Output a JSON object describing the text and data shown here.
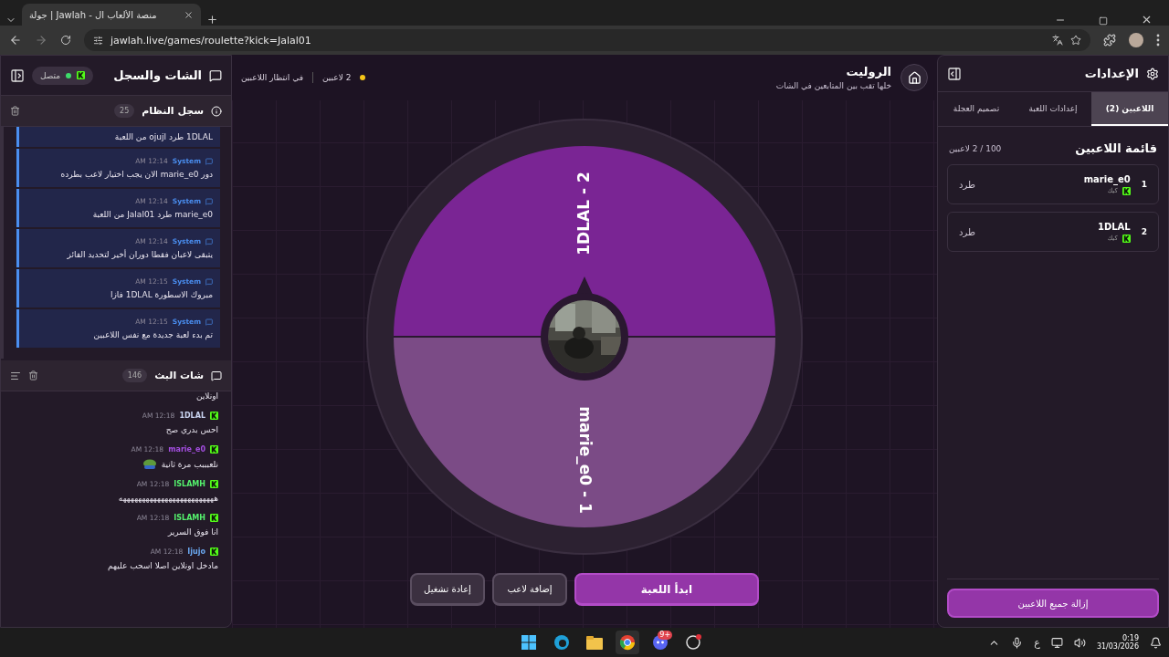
{
  "browser": {
    "tab_title": "جولة | Jawlah - منصة الألعاب ال",
    "url": "jawlah.live/games/roulette?kick=Jalal01"
  },
  "chat_panel": {
    "title": "الشات والسجل",
    "status": {
      "label": "متصل",
      "online": true
    },
    "system_log": {
      "title": "سجل النظام",
      "count": "25",
      "entries": [
        {
          "text": "1DLAL طرد ojujl من اللعبة"
        },
        {
          "author": "System",
          "time": "AM 12:14",
          "text": "دور marie_e0 الان يجب اختيار لاعب بطرده"
        },
        {
          "author": "System",
          "time": "AM 12:14",
          "text": "marie_e0 طرد Jalal01 من اللعبة"
        },
        {
          "author": "System",
          "time": "AM 12:14",
          "text": "يتبقى لاعبان فقطا دوران أخير لتحديد الفائز"
        },
        {
          "author": "System",
          "time": "AM 12:15",
          "text": "مبروك الاسطورة 1DLAL فازا"
        },
        {
          "author": "System",
          "time": "AM 12:15",
          "text": "تم بدء لعبة جديدة مع نفس اللاعبين"
        }
      ]
    },
    "stream_chat": {
      "title": "شات البث",
      "count": "146",
      "messages": [
        {
          "text": "اونلاين"
        },
        {
          "user": "1DLAL",
          "color": "#c9d3f0",
          "time": "AM 12:18",
          "text": "احس بدري صح"
        },
        {
          "user": "marie_e0",
          "color": "#a44ee0",
          "time": "AM 12:18",
          "text": "نلعبببب مرة ثانية",
          "emote": true
        },
        {
          "user": "ISLAMH",
          "color": "#54f06c",
          "time": "AM 12:18",
          "text": "هههههههههههههههههههههههههه"
        },
        {
          "user": "ISLAMH",
          "color": "#54f06c",
          "time": "AM 12:18",
          "text": "انا فوق السرير"
        },
        {
          "user": "Ijujo",
          "color": "#6aa8f0",
          "time": "AM 12:18",
          "text": "مادخل اونلاين اصلا اسحب عليهم"
        }
      ]
    }
  },
  "game": {
    "title": "الروليت",
    "subtitle": "خلها تقب بين المتابعين في الشات",
    "players_status": "2 لاعبين",
    "state": "في انتظار اللاعبين",
    "segments": [
      {
        "label": "1DLAL - 2",
        "color": "#7a2594"
      },
      {
        "label": "marie_e0 - 1",
        "color": "#7b4b86"
      }
    ],
    "buttons": [
      {
        "label": "ابدأ اللعبة",
        "kind": "primary"
      },
      {
        "label": "إضافة لاعب",
        "kind": "secondary"
      },
      {
        "label": "إعادة تشغيل",
        "kind": "secondary"
      }
    ]
  },
  "settings_panel": {
    "title": "الإعدادات",
    "tabs": [
      {
        "label": "اللاعبين (2)",
        "selected": true
      },
      {
        "label": "إعدادات اللعبة",
        "selected": false
      },
      {
        "label": "تصميم العجلة",
        "selected": false
      }
    ],
    "list_title": "قائمة اللاعبين",
    "list_count": "100 / 2 لاعبين",
    "players": [
      {
        "number": "1",
        "name": "marie_e0",
        "platform": "كيك",
        "action": "طرد"
      },
      {
        "number": "2",
        "name": "1DLAL",
        "platform": "كيك",
        "action": "طرد"
      }
    ],
    "remove_all": "إزالة جميع اللاعبين"
  },
  "taskbar": {
    "discord_badge": "9+",
    "language": "ع",
    "time": "0:19",
    "date": "31/03/2026"
  }
}
